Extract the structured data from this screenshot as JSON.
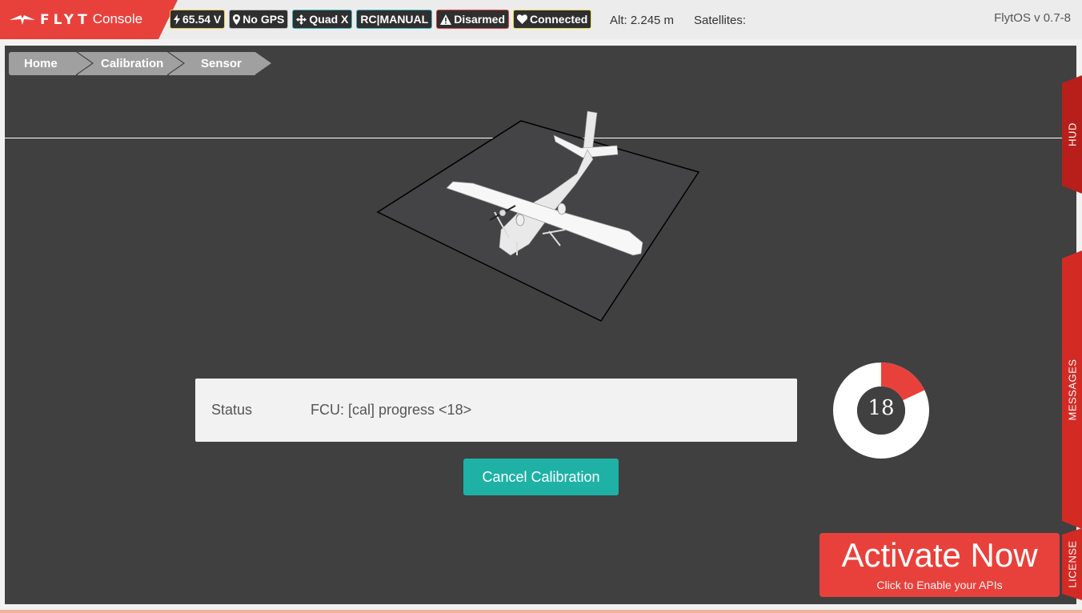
{
  "header": {
    "logo_word": "FLYT",
    "logo_console": "Console",
    "badges": {
      "voltage": "65.54 V",
      "gps": "No GPS",
      "frame": "Quad X",
      "mode": "RC|MANUAL",
      "arm": "Disarmed",
      "connection": "Connected"
    },
    "altitude": "Alt: 2.245 m",
    "satellites": "Satellites:",
    "version": "FlytOS v 0.7-8"
  },
  "breadcrumb": [
    "Home",
    "Calibration",
    "Sensor"
  ],
  "status": {
    "label": "Status",
    "text": "FCU: [cal] progress <18>"
  },
  "cancel_button": "Cancel Calibration",
  "progress": {
    "value": 18,
    "display": "18"
  },
  "side_tabs": {
    "hud": "HUD",
    "messages": "MESSAGES",
    "license": "LICENSE"
  },
  "activate": {
    "title": "Activate Now",
    "subtitle": "Click to Enable your APIs"
  },
  "colors": {
    "brand_red": "#e8413c",
    "teal": "#1fb1a6",
    "stage_bg": "#404040",
    "badge_voltage": "#e7c94a",
    "badge_gps": "#b8b8b8",
    "badge_frame": "#3fb6c7",
    "badge_mode": "#3fb6c7",
    "badge_arm": "#e8413c",
    "badge_connection": "#e7d84a"
  },
  "icons": {
    "voltage": "lightning-icon",
    "gps": "map-pin-icon",
    "frame": "move-arrows-icon",
    "arm": "warning-triangle-icon",
    "connection": "heart-icon"
  }
}
